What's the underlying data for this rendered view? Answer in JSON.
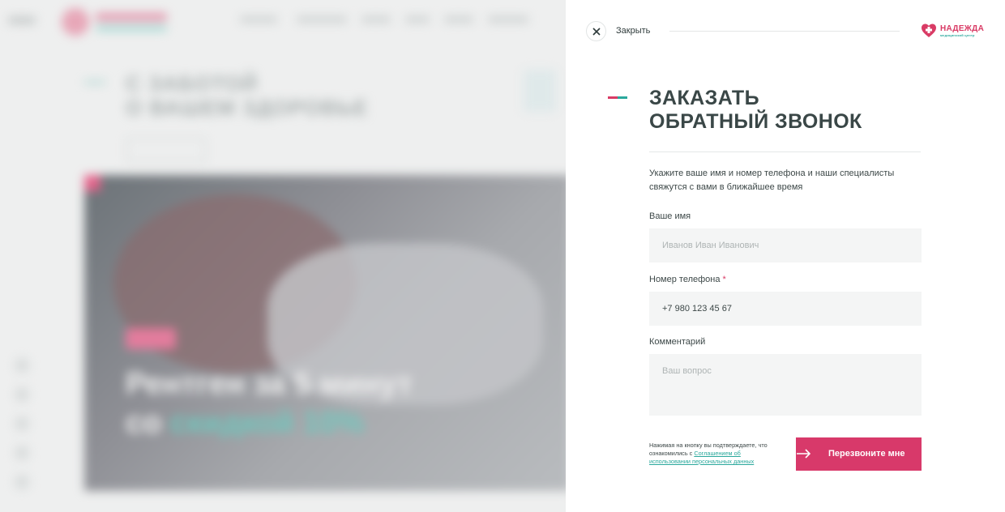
{
  "panel": {
    "close_label": "Закрыть",
    "logo": {
      "name": "НАДЕЖДА",
      "subtitle": "медицинский центр"
    },
    "title_line1": "ЗАКАЗАТЬ",
    "title_line2": "ОБРАТНЫЙ ЗВОНОК",
    "description": "Укажите ваше имя и номер телефона и наши специалисты свяжутся с вами в ближайшее время",
    "name_field": {
      "label": "Ваше имя",
      "placeholder": "Иванов Иван Иванович",
      "value": ""
    },
    "phone_field": {
      "label": "Номер телефона",
      "required_mark": "*",
      "value": "+7 980 123 45 67"
    },
    "comment_field": {
      "label": "Комментарий",
      "placeholder": "Ваш вопрос",
      "value": ""
    },
    "consent_text": "Нажимая на кнопку вы подтверждаете, что ознакомились с ",
    "consent_link": "Соглашением об использовании персональных данных",
    "submit_label": "Перезвоните мне",
    "colors": {
      "accent_pink": "#d8396a",
      "accent_teal": "#2aa89c",
      "text_dark": "#3a4747"
    }
  },
  "background": {
    "heading_line1": "С ЗАБОТОЙ",
    "heading_line2": "О ВАШЕМ ЗДОРОВЬЕ",
    "hero_title_line1": "Рентген за 5 минут",
    "hero_title_line2_prefix": "со ",
    "hero_title_line2_accent": "скидкой 10%"
  }
}
